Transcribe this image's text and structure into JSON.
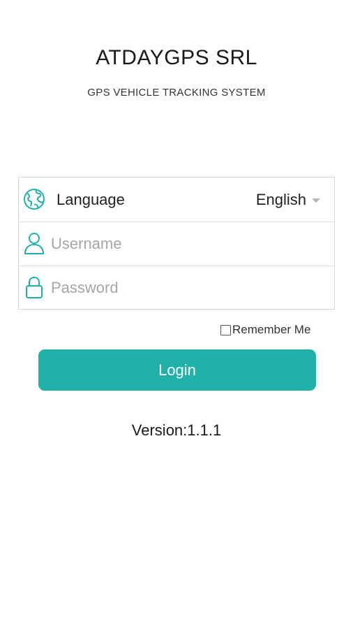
{
  "header": {
    "title": "ATDAYGPS SRL",
    "subtitle": "GPS VEHICLE TRACKING SYSTEM"
  },
  "form": {
    "language": {
      "icon": "globe-icon",
      "label": "Language",
      "selected": "English"
    },
    "username": {
      "icon": "user-icon",
      "placeholder": "Username",
      "value": ""
    },
    "password": {
      "icon": "lock-icon",
      "placeholder": "Password",
      "value": ""
    },
    "remember": {
      "label": "Remember Me",
      "checked": false
    },
    "login_label": "Login"
  },
  "footer": {
    "version": "Version:1.1.1"
  },
  "colors": {
    "accent": "#20b2aa",
    "icon": "#20b2aa",
    "border": "#d9d9d9"
  }
}
